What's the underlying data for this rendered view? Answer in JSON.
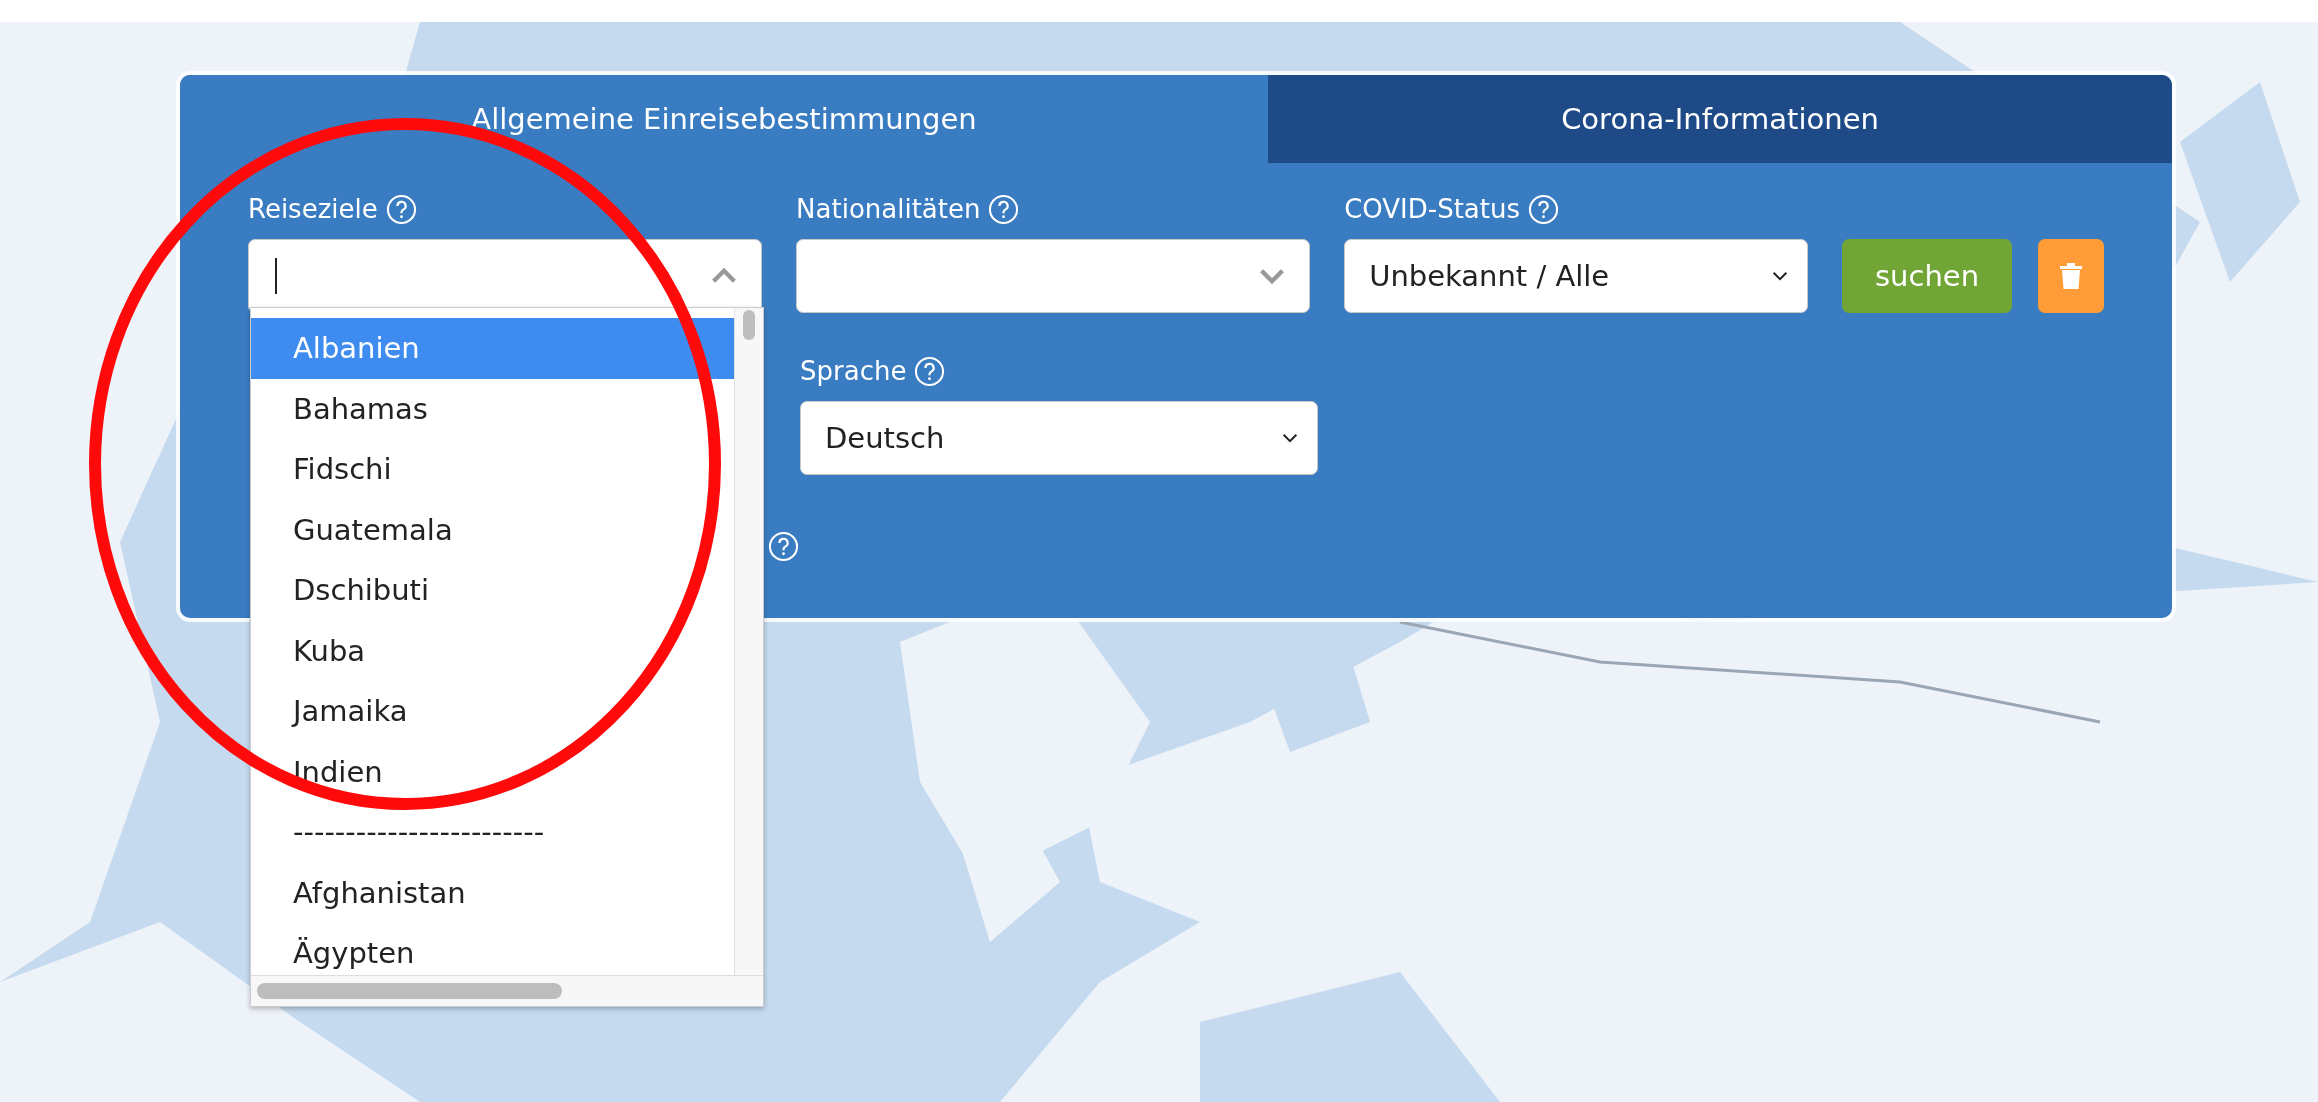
{
  "tabs": [
    {
      "label": "Allgemeine Einreisebestimmungen",
      "selected": true
    },
    {
      "label": "Corona-Informationen",
      "selected": false
    }
  ],
  "fields": [
    {
      "label": "Reiseziele",
      "kind": "combobox",
      "expanded": true,
      "options": [
        {
          "label": "Albanien",
          "selected": true
        },
        {
          "label": "Bahamas",
          "selected": false
        },
        {
          "label": "Fidschi",
          "selected": false
        },
        {
          "label": "Guatemala",
          "selected": false
        },
        {
          "label": "Dschibuti",
          "selected": false
        },
        {
          "label": "Kuba",
          "selected": false
        },
        {
          "label": "Jamaika",
          "selected": false
        },
        {
          "label": "Indien",
          "selected": false
        },
        {
          "label": "------------------------",
          "selected": false
        },
        {
          "label": "Afghanistan",
          "selected": false
        },
        {
          "label": "Ägypten",
          "selected": false
        }
      ]
    },
    {
      "label": "Nationalitäten",
      "kind": "combobox",
      "expanded": false
    },
    {
      "label": "COVID-Status",
      "kind": "select",
      "value": "Unbekannt / Alle"
    },
    {
      "label": "Sprache",
      "kind": "select",
      "value": "Deutsch"
    }
  ],
  "buttons": [
    {
      "kind": "text",
      "label": "suchen"
    },
    {
      "kind": "trash"
    }
  ],
  "annotations": [
    {
      "kind": "ellipse"
    }
  ]
}
